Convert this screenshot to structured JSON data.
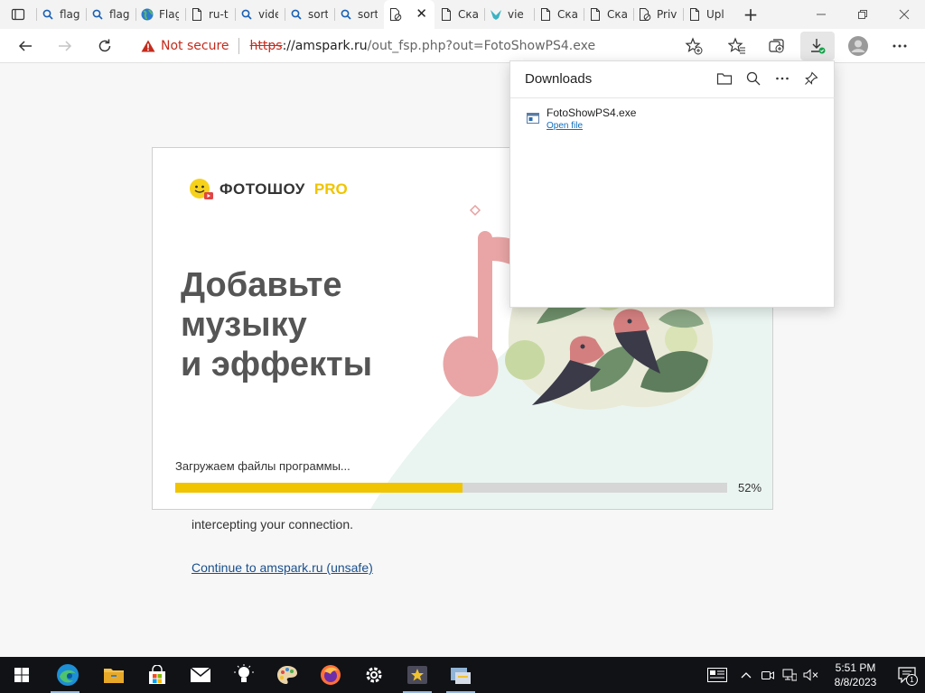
{
  "browser": {
    "tabs": [
      {
        "title": "flag",
        "icon": "search-icon"
      },
      {
        "title": "flag",
        "icon": "search-icon"
      },
      {
        "title": "Flag",
        "icon": "globe-icon"
      },
      {
        "title": "ru-t",
        "icon": "page-icon"
      },
      {
        "title": "vide",
        "icon": "search-icon"
      },
      {
        "title": "sort",
        "icon": "search-icon"
      },
      {
        "title": "sort",
        "icon": "search-icon"
      },
      {
        "title": "",
        "icon": "blocked-page-icon",
        "active": true
      },
      {
        "title": "Ска",
        "icon": "page-icon"
      },
      {
        "title": "vie",
        "icon": "bird-icon"
      },
      {
        "title": "Ска",
        "icon": "page-icon"
      },
      {
        "title": "Ска",
        "icon": "page-icon"
      },
      {
        "title": "Priv",
        "icon": "blocked-page-icon"
      },
      {
        "title": "Upl",
        "icon": "page-icon"
      }
    ],
    "security_label": "Not secure",
    "url_scheme": "https",
    "url_host": "://amspark.ru",
    "url_path": "/out_fsp.php?out=FotoShowPS4.exe"
  },
  "page": {
    "warning_text": "computer's operating system. This may be caused by a misconfiguration or an attacker intercepting your connection.",
    "continue_link": "Continue to amspark.ru (unsafe)"
  },
  "installer": {
    "brand": "ФОТОШОУ",
    "brand_suffix": "PRO",
    "heading_line1": "Добавьте",
    "heading_line2": "музыку",
    "heading_line3": "и эффекты",
    "status": "Загружаем файлы программы...",
    "progress_percent": 52,
    "progress_label": "52%",
    "accent_color": "#f0c400"
  },
  "downloads": {
    "title": "Downloads",
    "file_name": "FotoShowPS4.exe",
    "open_link": "Open file"
  },
  "taskbar": {
    "time": "5:51 PM",
    "date": "8/8/2023",
    "apps": [
      "edge-icon",
      "file-explorer-icon",
      "store-icon",
      "mail-icon",
      "tips-icon",
      "paint-icon",
      "firefox-icon",
      "settings-icon",
      "fotoshow-icon",
      "installer-icon"
    ],
    "notification_count": "1"
  }
}
